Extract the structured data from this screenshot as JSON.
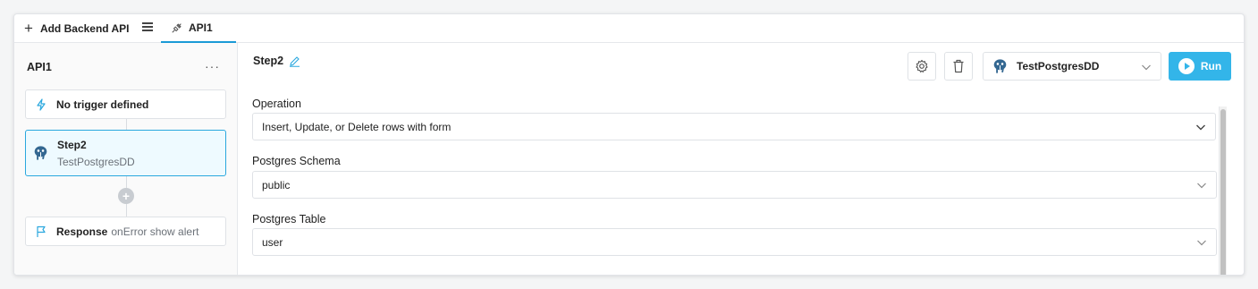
{
  "tabs": {
    "add_label": "Add Backend API",
    "api_tab_label": "API1"
  },
  "left": {
    "title": "API1",
    "more": "···",
    "trigger_label": "No trigger defined",
    "step": {
      "name": "Step2",
      "source": "TestPostgresDD"
    },
    "response": {
      "label": "Response",
      "sub": "onError show alert"
    }
  },
  "right": {
    "step_name": "Step2",
    "source_name": "TestPostgresDD",
    "run_label": "Run",
    "fields": [
      {
        "label": "Operation",
        "value": "Insert, Update, or Delete rows with form"
      },
      {
        "label": "Postgres Schema",
        "value": "public"
      },
      {
        "label": "Postgres Table",
        "value": "user"
      }
    ]
  },
  "colors": {
    "accent": "#33b5e9",
    "selected_border": "#2ba8de",
    "selected_bg": "#eefaff"
  }
}
